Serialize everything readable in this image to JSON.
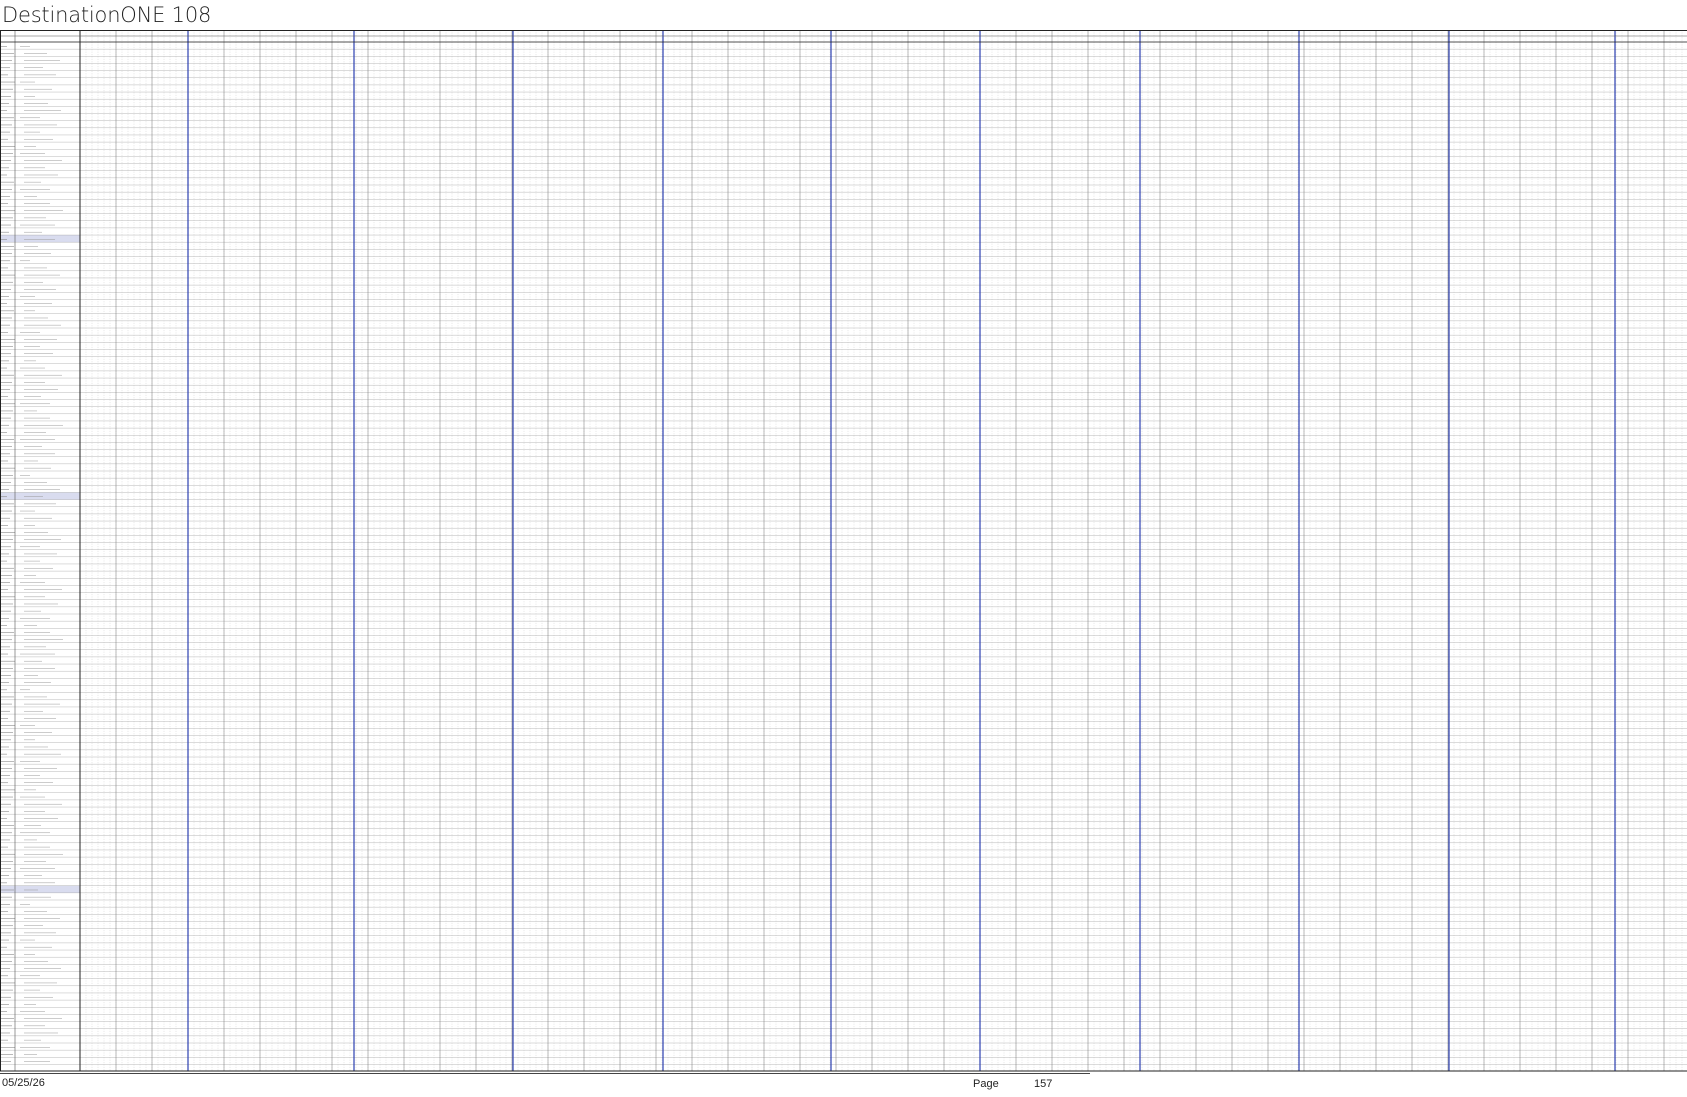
{
  "document": {
    "title": "DestinationONE 108"
  },
  "grid": {
    "header_left_cols": [
      "",
      ""
    ],
    "line_color": "#9a9a9a",
    "separator_color": "#2c3fb0",
    "highlight_row_color": "#d9dcef"
  },
  "footer": {
    "date": "05/25/26",
    "page_label": "Page",
    "page_number": "157"
  }
}
